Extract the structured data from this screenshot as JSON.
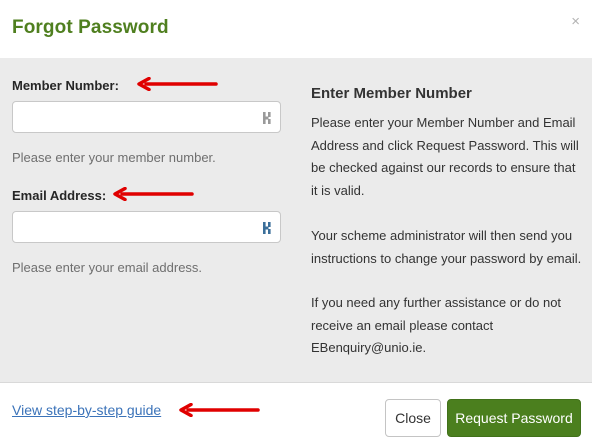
{
  "dialog": {
    "title": "Forgot Password",
    "close_glyph": "×"
  },
  "form": {
    "member_number": {
      "label": "Member Number:",
      "value": "",
      "help": "Please enter your member number.",
      "icon": "password-manager-icon"
    },
    "email": {
      "label": "Email Address:",
      "value": "",
      "help": "Please enter your email address.",
      "icon": "password-manager-icon"
    }
  },
  "info": {
    "title": "Enter Member Number",
    "paragraph1": "Please enter your Member Number and Email Address and click Request Password. This will be checked against our records to ensure that it is valid.",
    "paragraph2": "Your scheme administrator will then send you instructions to change your password by email.",
    "paragraph3": "If you need any further assistance or do not receive an email please contact EBenquiry@unio.ie."
  },
  "footer": {
    "guide_link": "View step-by-step guide",
    "close_label": "Close",
    "request_label": "Request Password"
  },
  "colors": {
    "accent": "#4b7f1e",
    "annotation_arrow": "#e00000",
    "link": "#3b73b9"
  }
}
